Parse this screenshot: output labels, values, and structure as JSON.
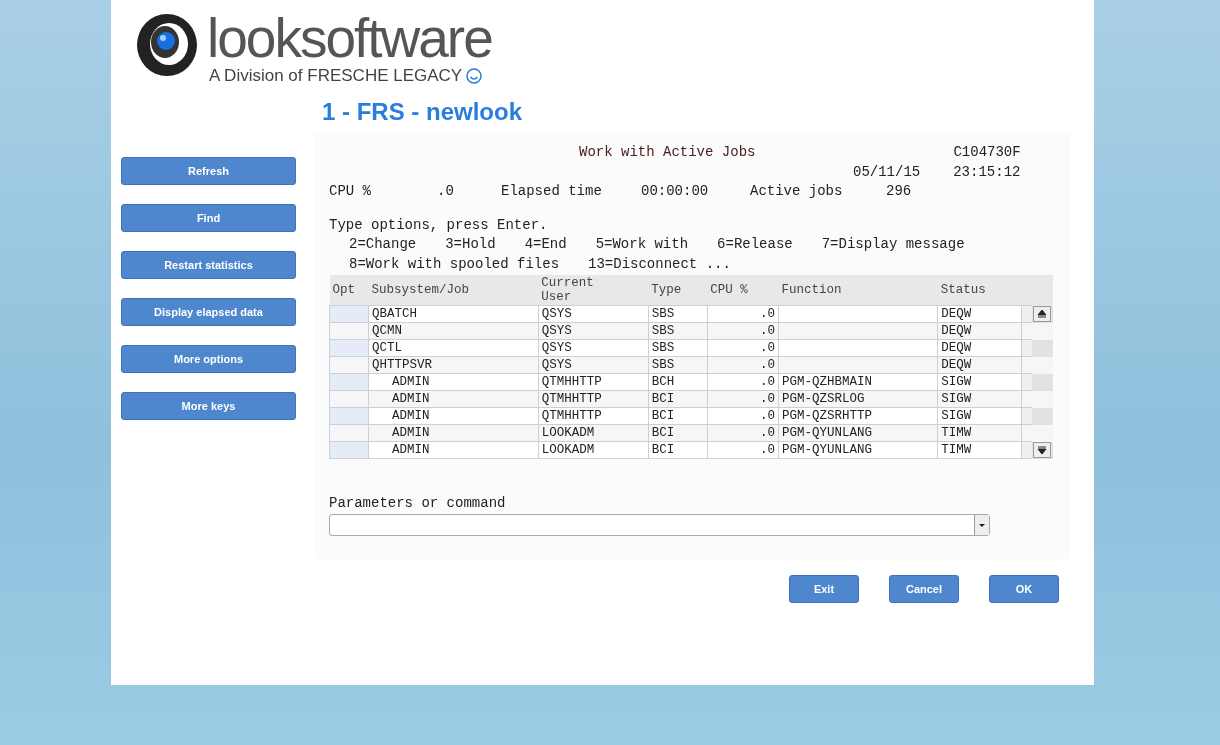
{
  "logo": {
    "name": "looksoftware",
    "tagline": "A Division of FRESCHE LEGACY"
  },
  "session_title": "1 - FRS - newlook",
  "sidebar_buttons": [
    "Refresh",
    "Find",
    "Restart statistics",
    "Display elapsed data",
    "More options",
    "More keys"
  ],
  "screen": {
    "title": "Work with Active Jobs",
    "system": "C104730F",
    "date": "05/11/15",
    "time": "23:15:12",
    "stats": [
      {
        "label": "CPU %",
        "value": ".0"
      },
      {
        "label": "Elapsed time",
        "value": "00:00:00"
      },
      {
        "label": "Active jobs",
        "value": "296"
      }
    ],
    "instruction": "Type options, press Enter.",
    "options": [
      [
        "2=Change",
        "3=Hold",
        "4=End",
        "5=Work with",
        "6=Release",
        "7=Display message"
      ],
      [
        "8=Work with spooled files",
        "13=Disconnect ..."
      ]
    ],
    "table": {
      "columns": [
        "Opt",
        "Subsystem/Job",
        "Current User",
        "Type",
        "CPU %",
        "Function",
        "Status"
      ],
      "rows": [
        {
          "kind": "subsystem",
          "job": "QBATCH",
          "user": "QSYS",
          "type": "SBS",
          "cpu": ".0",
          "status": "DEQW"
        },
        {
          "kind": "subsystem",
          "job": "QCMN",
          "user": "QSYS",
          "type": "SBS",
          "cpu": ".0",
          "status": "DEQW"
        },
        {
          "kind": "subsystem",
          "job": "QCTL",
          "user": "QSYS",
          "type": "SBS",
          "cpu": ".0",
          "status": "DEQW"
        },
        {
          "kind": "subsystem",
          "job": "QHTTPSVR",
          "user": "QSYS",
          "type": "SBS",
          "cpu": ".0",
          "status": "DEQW"
        },
        {
          "kind": "job",
          "job": "ADMIN",
          "user": "QTMHHTTP",
          "type": "BCH",
          "cpu": ".0",
          "function": "PGM-QZHBMAIN",
          "status": "SIGW"
        },
        {
          "kind": "job",
          "job": "ADMIN",
          "user": "QTMHHTTP",
          "type": "BCI",
          "cpu": ".0",
          "function": "PGM-QZSRLOG",
          "status": "SIGW"
        },
        {
          "kind": "job",
          "job": "ADMIN",
          "user": "QTMHHTTP",
          "type": "BCI",
          "cpu": ".0",
          "function": "PGM-QZSRHTTP",
          "status": "SIGW"
        },
        {
          "kind": "job",
          "job": "ADMIN",
          "user": "LOOKADM",
          "type": "BCI",
          "cpu": ".0",
          "function": "PGM-QYUNLANG",
          "status": "TIMW"
        },
        {
          "kind": "job",
          "job": "ADMIN",
          "user": "LOOKADM",
          "type": "BCI",
          "cpu": ".0",
          "function": "PGM-QYUNLANG",
          "status": "TIMW"
        }
      ]
    },
    "command": {
      "label": "Parameters or command"
    }
  },
  "buttons": [
    "Exit",
    "Cancel",
    "OK"
  ]
}
